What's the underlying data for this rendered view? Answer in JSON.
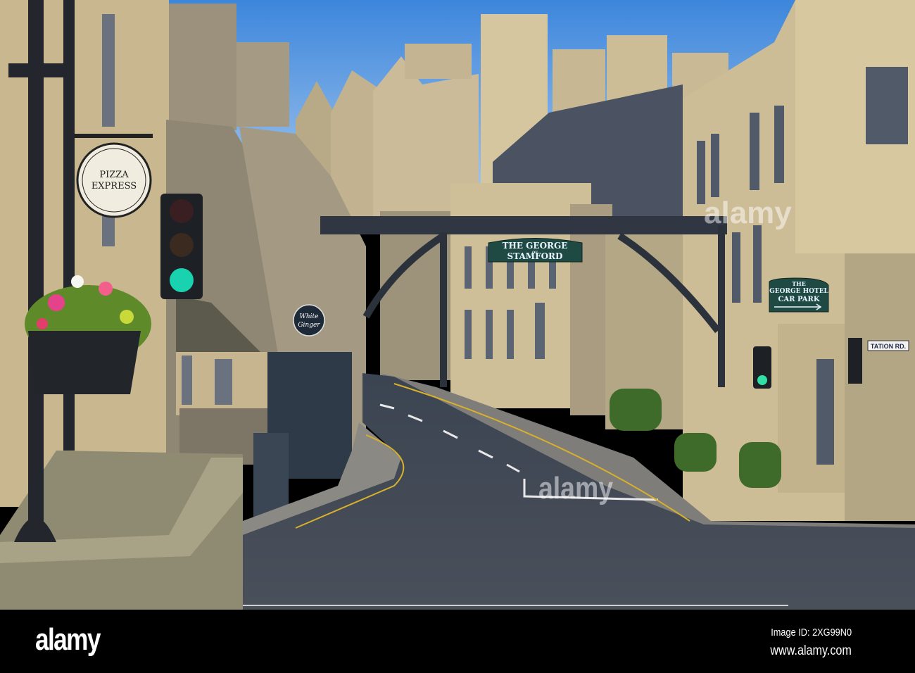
{
  "signs": {
    "pizza_express": [
      "PIZZA",
      "EXPRESS"
    ],
    "white_ginger": [
      "White",
      "Ginger"
    ],
    "george_of_stamford": [
      "THE GEORGE",
      "OF",
      "STAMFORD"
    ],
    "george_hotel_car_park": [
      "THE",
      "GEORGE HOTEL",
      "CAR PARK"
    ],
    "street_name": "TATION RD."
  },
  "watermark": "alamy",
  "footer": {
    "logo": "alamy",
    "image_id": "Image ID: 2XG99N0",
    "url": "www.alamy.com"
  },
  "colors": {
    "sky": "#5a9be0",
    "stone": "#c9b78f",
    "road": "#3f4652",
    "sign_green": "#1f4a44"
  }
}
